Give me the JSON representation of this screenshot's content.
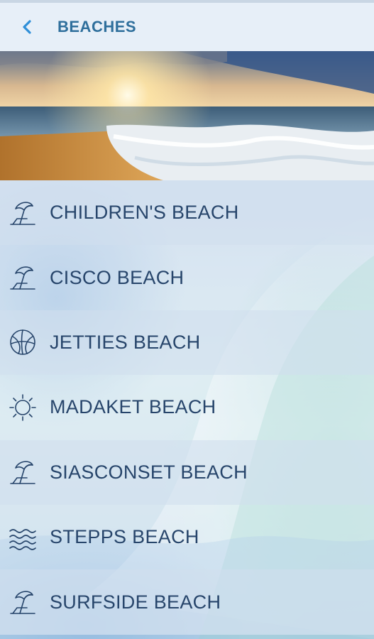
{
  "header": {
    "title": "BEACHES",
    "back_icon": "chevron-left-icon",
    "accent": "#2f8fd8"
  },
  "hero": {
    "description_icon": "beach-sunset-photo"
  },
  "beaches": [
    {
      "label": "CHILDREN'S BEACH",
      "icon": "umbrella-icon"
    },
    {
      "label": "CISCO BEACH",
      "icon": "umbrella-icon"
    },
    {
      "label": "JETTIES BEACH",
      "icon": "beach-ball-icon"
    },
    {
      "label": "MADAKET BEACH",
      "icon": "sun-icon"
    },
    {
      "label": "SIASCONSET BEACH",
      "icon": "umbrella-icon"
    },
    {
      "label": "STEPPS BEACH",
      "icon": "waves-icon"
    },
    {
      "label": "SURFSIDE BEACH",
      "icon": "umbrella-icon"
    }
  ]
}
